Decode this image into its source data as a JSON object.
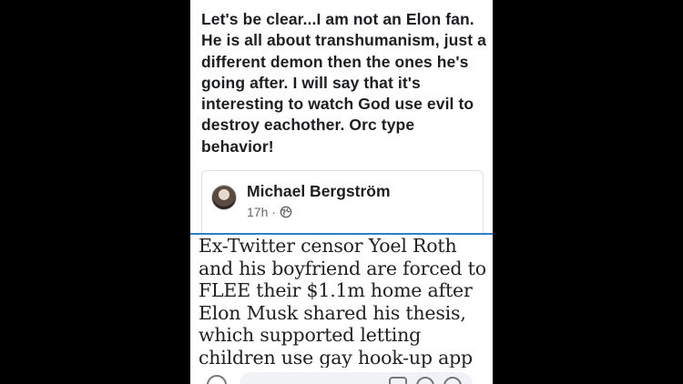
{
  "post": {
    "text_lines": [
      "Let's be clear...I am not an Elon fan.",
      "He is all about transhumanism, just a",
      "different demon then the ones he's",
      "going after. I will say that it's",
      "interesting to watch God use evil to",
      "destroy eachother. Orc type",
      "behavior!"
    ]
  },
  "shared": {
    "author": "Michael Bergström",
    "time": "17h",
    "separator": "·",
    "privacy_icon": "globe-icon"
  },
  "article": {
    "lines": [
      "Ex-Twitter censor Yoel Roth",
      "and his boyfriend are forced to",
      "FLEE their $1.1m home after",
      "Elon Musk shared his thesis,",
      "which supported letting",
      "children use gay hook-up app"
    ]
  },
  "colors": {
    "background": "#000000",
    "panel": "#ffffff",
    "text": "#1c1e21",
    "secondary_text": "#65676b",
    "divider": "#2c80c5"
  }
}
